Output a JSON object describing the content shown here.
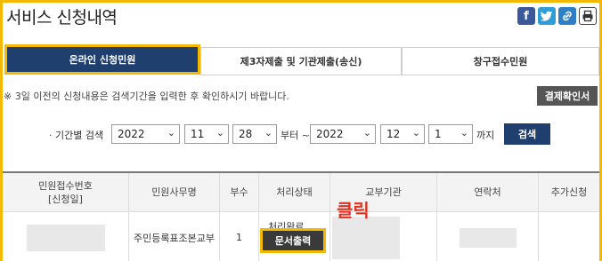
{
  "header": {
    "title": "서비스 신청내역",
    "share_icons": [
      "facebook-icon",
      "twitter-icon",
      "link-icon",
      "print-icon"
    ]
  },
  "tabs": [
    {
      "label": "온라인 신청민원",
      "active": true
    },
    {
      "label": "제3자제출 및 기관제출(송신)",
      "active": false
    },
    {
      "label": "창구접수민원",
      "active": false
    }
  ],
  "notice": "※ 3일 이전의 신청내용은 검색기간을 입력한 후 확인하시기 바랍니다.",
  "receipt_button": "결제확인서",
  "search": {
    "period_label": "· 기간별 검색",
    "from": {
      "year": "2022",
      "month": "11",
      "day": "28"
    },
    "from_suffix": "부터 ~",
    "to": {
      "year": "2022",
      "month": "12",
      "day": "1"
    },
    "to_suffix": "까지",
    "button": "검색"
  },
  "table": {
    "headers": [
      "민원접수번호\n[신청일]",
      "민원사무명",
      "부수",
      "처리상태",
      "교부기관",
      "연락처",
      "추가신청"
    ],
    "rows": [
      {
        "receipt_no": "",
        "name": "주민등록표조본교부",
        "copies": "1",
        "status": "처리완료",
        "action": "문서출력",
        "agency": "",
        "contact": "",
        "extra": ""
      }
    ]
  },
  "annotation": "클릭",
  "colors": {
    "accent": "#f5b800",
    "navy": "#1f3f6e",
    "annotation": "#e03020"
  }
}
